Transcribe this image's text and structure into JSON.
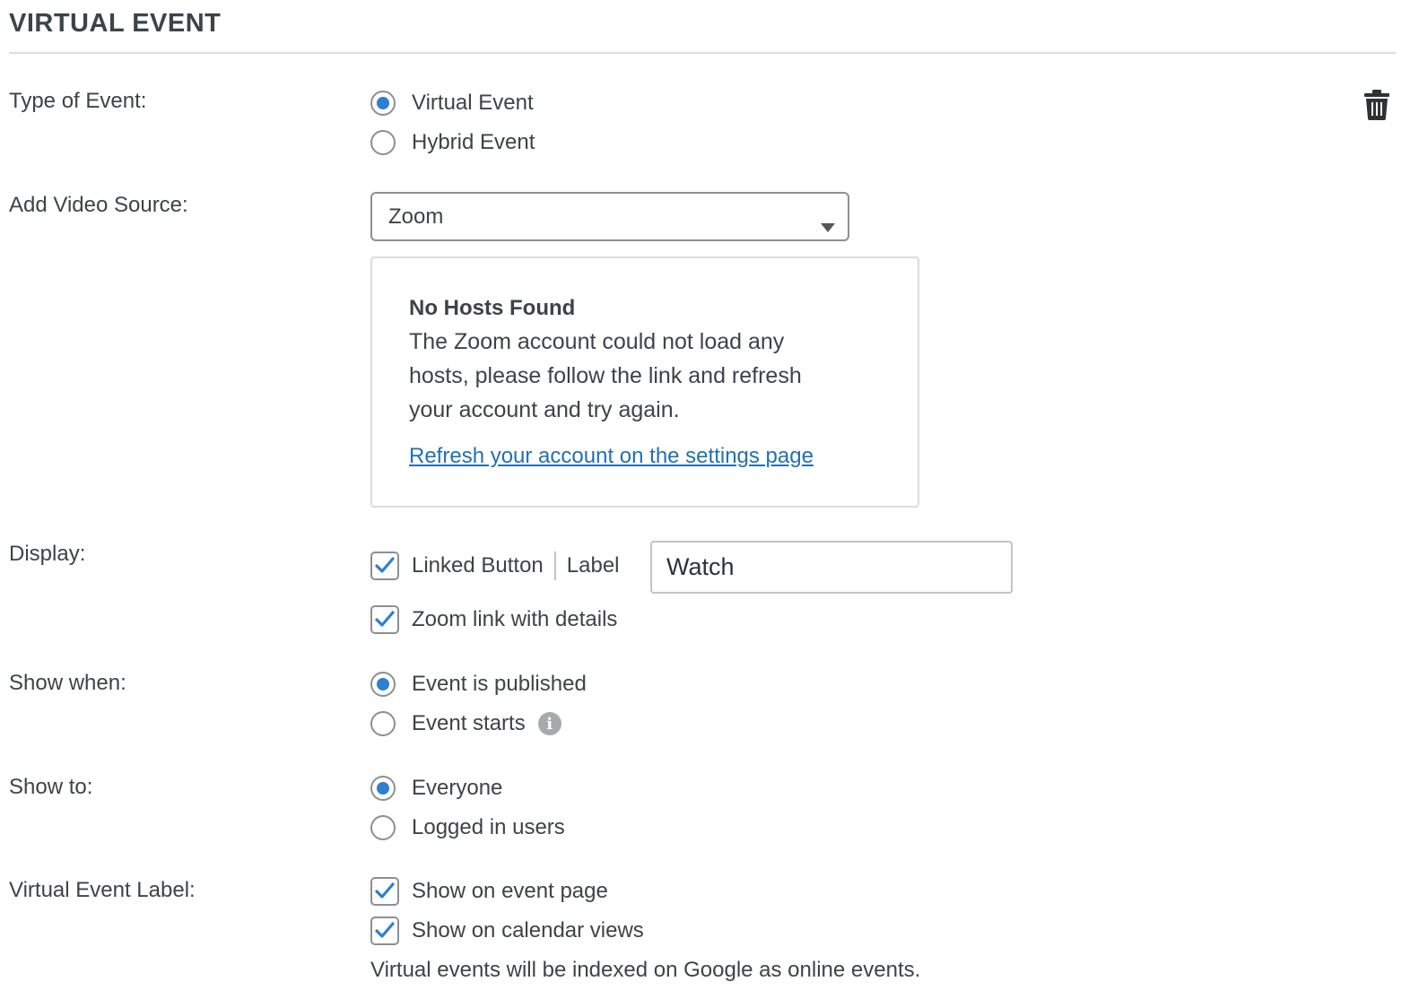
{
  "header": {
    "title": "VIRTUAL EVENT"
  },
  "type_of_event": {
    "label": "Type of Event:",
    "options": [
      {
        "label": "Virtual Event",
        "selected": true
      },
      {
        "label": "Hybrid Event",
        "selected": false
      }
    ]
  },
  "video_source": {
    "label": "Add Video Source:",
    "selected": "Zoom",
    "notice": {
      "heading": "No Hosts Found",
      "body": "The Zoom account could not load any hosts, please follow the link and refresh your account and try again.",
      "link": "Refresh your account on the settings page"
    }
  },
  "display": {
    "label": "Display:",
    "linked_button": {
      "label": "Linked Button",
      "checked": true
    },
    "button_label_caption": "Label",
    "button_label_value": "Watch",
    "zoom_link": {
      "label": "Zoom link with details",
      "checked": true
    }
  },
  "show_when": {
    "label": "Show when:",
    "options": [
      {
        "label": "Event is published",
        "selected": true
      },
      {
        "label": "Event starts",
        "selected": false
      }
    ]
  },
  "show_to": {
    "label": "Show to:",
    "options": [
      {
        "label": "Everyone",
        "selected": true
      },
      {
        "label": "Logged in users",
        "selected": false
      }
    ]
  },
  "virtual_event_label": {
    "label": "Virtual Event Label:",
    "options": [
      {
        "label": "Show on event page",
        "checked": true
      },
      {
        "label": "Show on calendar views",
        "checked": true
      }
    ],
    "note": "Virtual events will be indexed on Google as online events."
  },
  "colors": {
    "accent": "#2e7ed4",
    "link": "#2271b1",
    "text": "#3c434a"
  },
  "icons": {
    "delete": "trash-icon",
    "info": "info-icon",
    "dropdown": "chevron-down-icon",
    "check": "checkmark-icon"
  }
}
